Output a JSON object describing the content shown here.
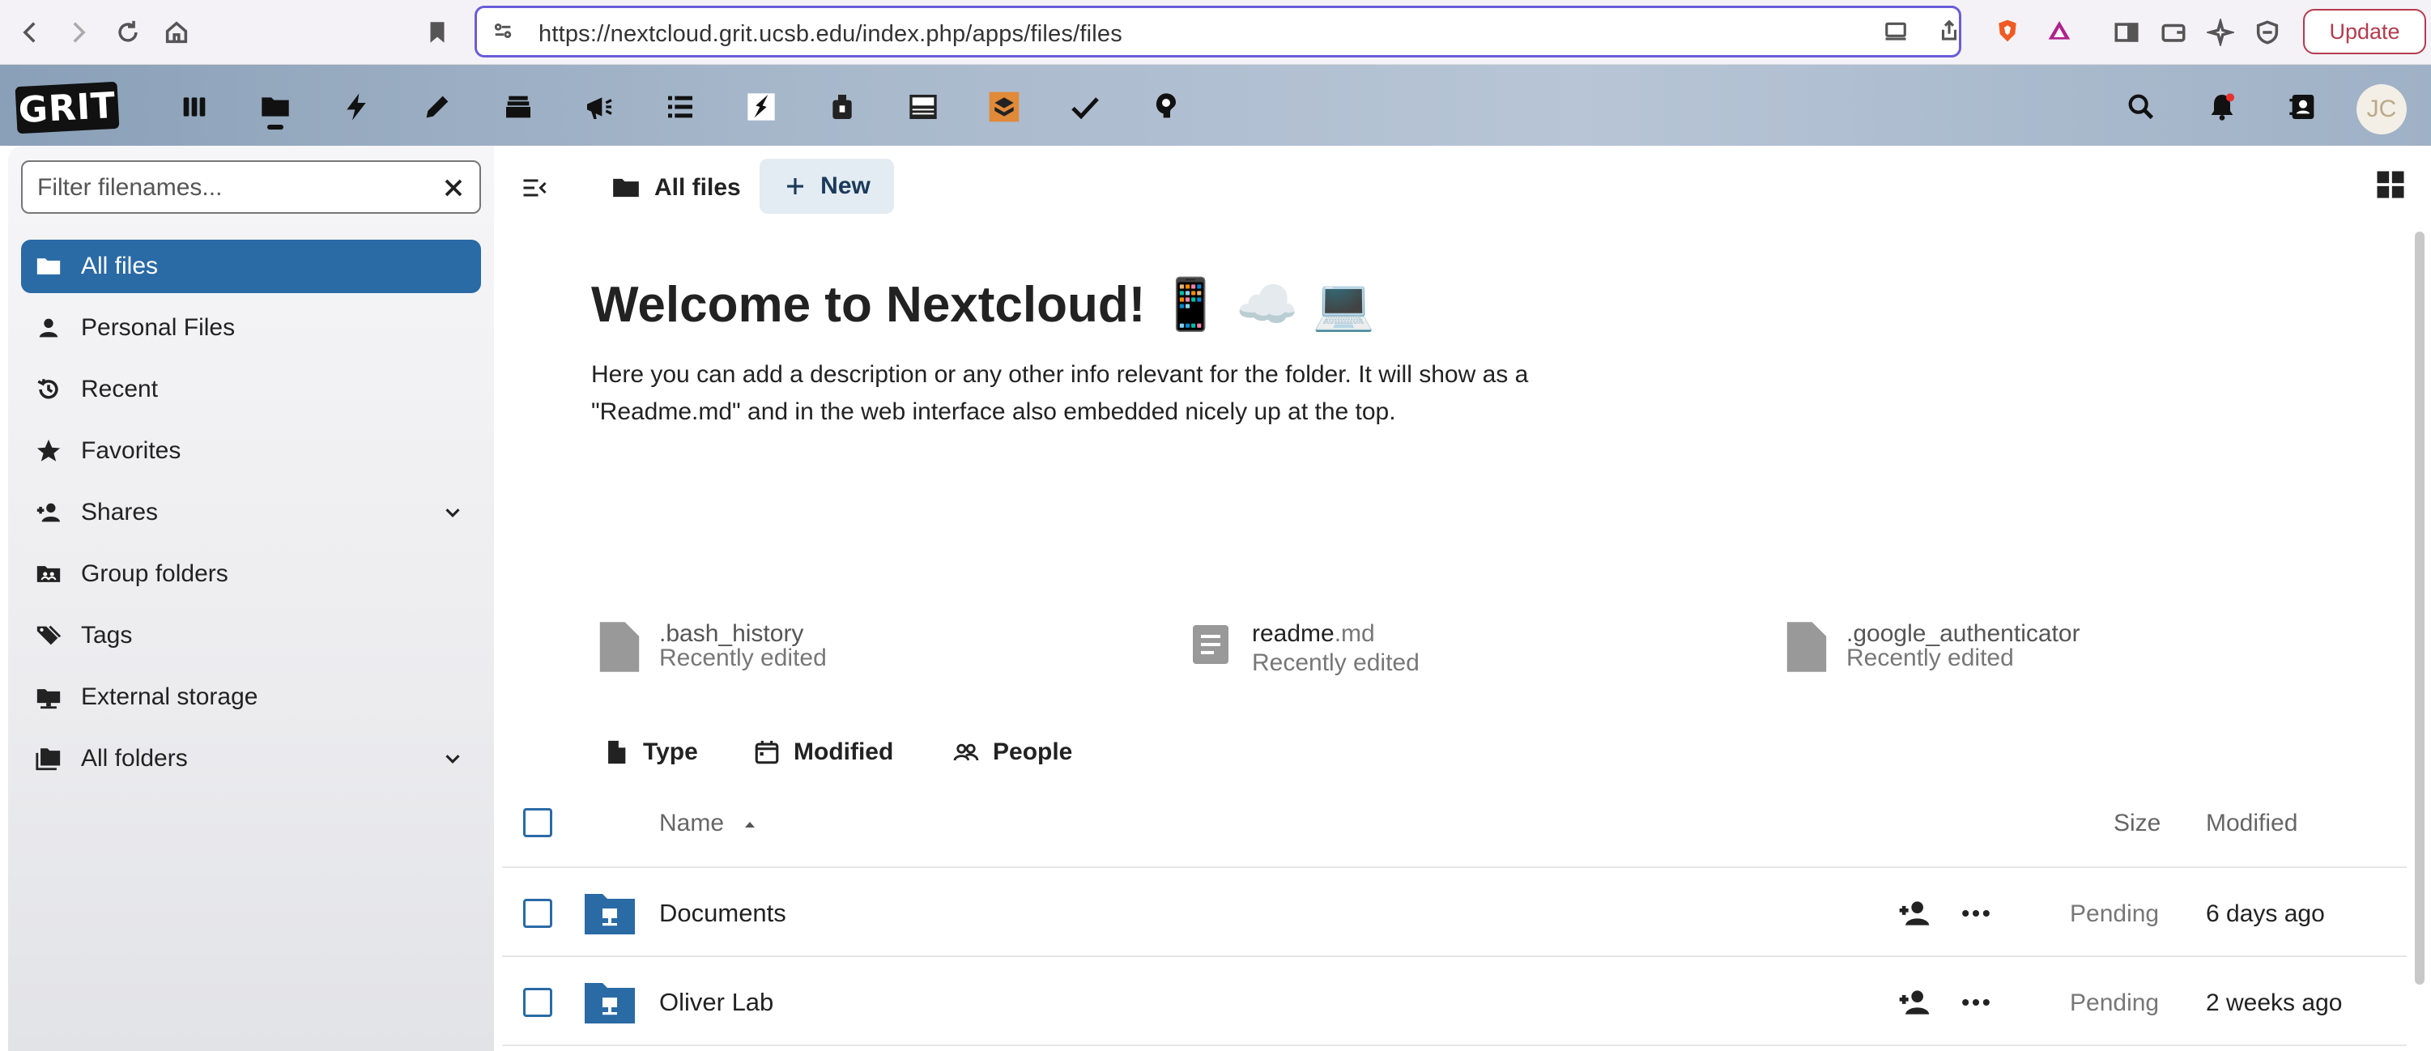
{
  "browser": {
    "url": "https://nextcloud.grit.ucsb.edu/index.php/apps/files/files",
    "update_label": "Update",
    "icons": [
      "back-icon",
      "forward-icon",
      "reload-icon",
      "home-icon",
      "bookmark-icon",
      "site-settings-icon",
      "cast-icon",
      "share-icon",
      "brave-shield-icon",
      "brave-rewards-icon",
      "sidebar-icon",
      "wallet-icon",
      "leo-icon",
      "vpn-icon"
    ]
  },
  "header": {
    "logo_text": "GRIT",
    "apps": [
      "dashboard",
      "files",
      "activity",
      "notes",
      "deck",
      "announcements",
      "tasks-list",
      "app-custom-1",
      "app-custom-2",
      "grit-app",
      "app-custom-3",
      "tasks-check",
      "ideas"
    ],
    "avatar_initials": "JC"
  },
  "sidebar": {
    "filter_placeholder": "Filter filenames...",
    "items": [
      {
        "label": "All files",
        "icon": "folder-icon",
        "active": true
      },
      {
        "label": "Personal Files",
        "icon": "person-icon"
      },
      {
        "label": "Recent",
        "icon": "history-icon"
      },
      {
        "label": "Favorites",
        "icon": "star-icon"
      },
      {
        "label": "Shares",
        "icon": "share-person-icon",
        "expandable": true
      },
      {
        "label": "Group folders",
        "icon": "group-folder-icon"
      },
      {
        "label": "Tags",
        "icon": "tag-icon"
      },
      {
        "label": "External storage",
        "icon": "external-storage-icon"
      },
      {
        "label": "All folders",
        "icon": "folders-icon",
        "expandable": true
      }
    ]
  },
  "main": {
    "breadcrumb": "All files",
    "new_label": "New",
    "welcome_title": "Welcome to Nextcloud! 📱 ☁️ 💻",
    "welcome_desc": "Here you can add a description or any other info relevant for the folder. It will show as a \"Readme.md\" and in the web interface also embedded nicely up at the top.",
    "recent": [
      {
        "name": ".bash_history",
        "ext": "",
        "sub": "Recently edited"
      },
      {
        "name": "readme",
        "ext": ".md",
        "sub": "Recently edited"
      },
      {
        "name": ".google_authenticator",
        "ext": "",
        "sub": "Recently edited"
      }
    ],
    "filters": [
      "Type",
      "Modified",
      "People"
    ],
    "columns": {
      "name": "Name",
      "size": "Size",
      "modified": "Modified"
    },
    "rows": [
      {
        "name": "Documents",
        "size": "Pending",
        "modified": "6 days ago"
      },
      {
        "name": "Oliver Lab",
        "size": "Pending",
        "modified": "2 weeks ago"
      }
    ]
  },
  "colors": {
    "accent": "#2a6aa5",
    "update": "#b33b4e",
    "urlbar_border": "#6a5cd8"
  }
}
